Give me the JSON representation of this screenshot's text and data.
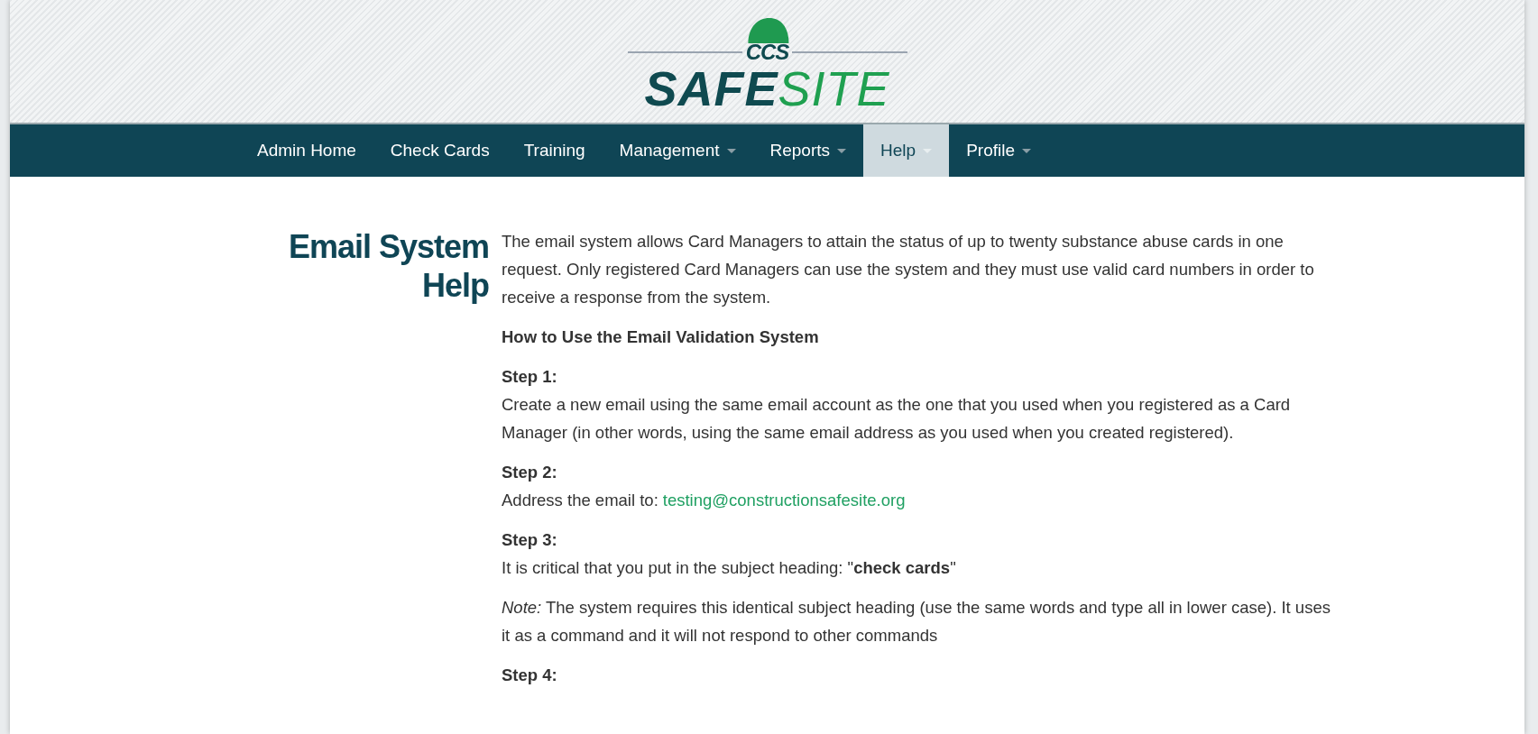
{
  "logo": {
    "top": "CCS",
    "word_dark": "SAFE",
    "word_light": "SITE"
  },
  "nav": [
    {
      "label": "Admin Home",
      "dropdown": false,
      "selected": false
    },
    {
      "label": "Check Cards",
      "dropdown": false,
      "selected": false
    },
    {
      "label": "Training",
      "dropdown": false,
      "selected": false
    },
    {
      "label": "Management",
      "dropdown": true,
      "selected": false
    },
    {
      "label": "Reports",
      "dropdown": true,
      "selected": false
    },
    {
      "label": "Help",
      "dropdown": true,
      "selected": true
    },
    {
      "label": "Profile",
      "dropdown": true,
      "selected": false
    }
  ],
  "heading": "Email System Help",
  "intro": "The email system allows Card Managers to attain the status of up to twenty substance abuse cards in one request. Only registered Card Managers can use the system and they must use valid card numbers in order to receive a response from the system.",
  "subheading": "How to Use the Email Validation System",
  "steps": [
    {
      "title": "Step 1:",
      "body": "Create a new email using the same email account as the one that you used when you registered as a Card Manager (in other words, using the same email address as you used when you created registered)."
    },
    {
      "title": "Step 2:",
      "body": "Address the email to:",
      "link": "testing@constructionsafesite.org"
    },
    {
      "title": "Step 3:",
      "body": "It is critical that you put in the subject heading: \"**check cards**\"",
      "note": "*Note:* The system requires this identical subject heading (use the same words and type all in lower case). It uses it as a command and it will not respond to other commands"
    },
    {
      "title": "Step 4:"
    }
  ]
}
